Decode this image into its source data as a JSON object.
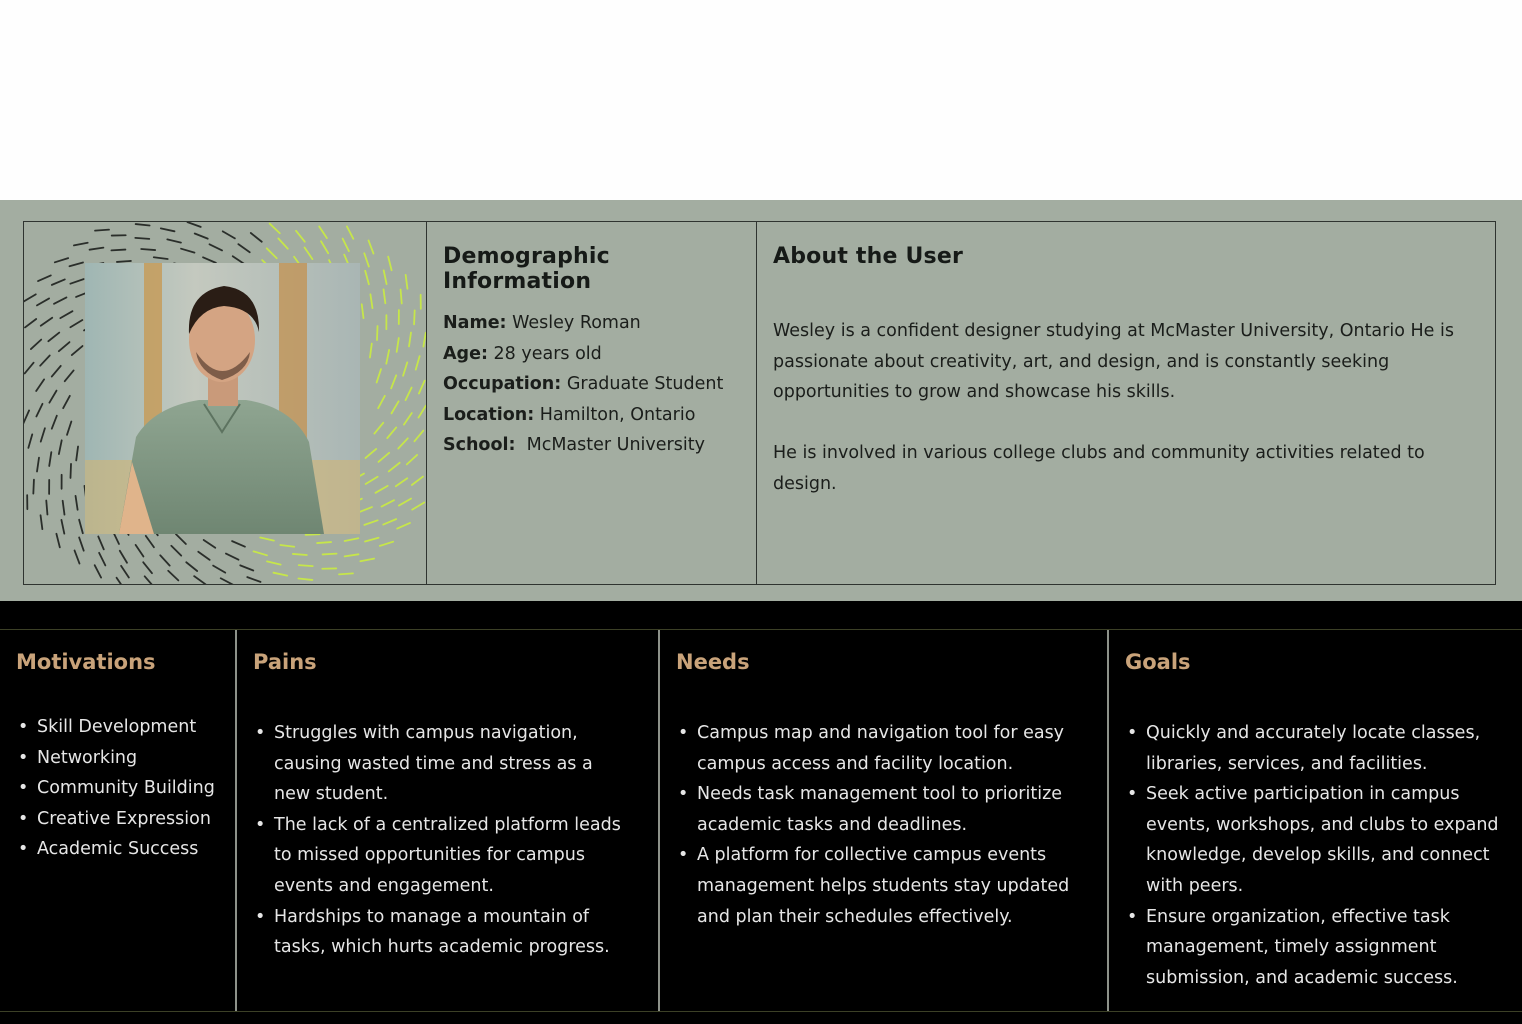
{
  "demographic": {
    "title": "Demographic Information",
    "name_label": "Name:",
    "name_value": " Wesley Roman",
    "age_label": "Age:",
    "age_value": " 28 years old",
    "occupation_label": "Occupation:",
    "occupation_value": " Graduate Student",
    "location_label": "Location:",
    "location_value": " Hamilton, Ontario",
    "school_label": "School:",
    "school_value": "  McMaster University"
  },
  "about": {
    "title": "About the User",
    "paragraph1": "Wesley is a confident designer studying at McMaster University, Ontario He is passionate about creativity, art, and design, and is constantly seeking opportunities to grow and showcase his skills.",
    "paragraph2": "He is involved in various college clubs and community activities related to design."
  },
  "motivations": {
    "title": "Motivations",
    "items": [
      "Skill Development",
      "Networking",
      "Community Building",
      "Creative Expression",
      "Academic Success"
    ]
  },
  "pains": {
    "title": "Pains",
    "items": [
      "Struggles with campus navigation, causing wasted time and stress as a new student.",
      "The lack of a centralized platform leads to missed opportunities for campus events and engagement.",
      "Hardships to manage a mountain of tasks, which hurts academic progress."
    ]
  },
  "needs": {
    "title": "Needs",
    "items": [
      "Campus map and navigation tool for easy campus access and facility location.",
      "Needs task management tool to prioritize academic tasks and deadlines.",
      "A platform for collective campus events management helps students stay updated and plan their schedules effectively."
    ]
  },
  "goals": {
    "title": "Goals",
    "items": [
      "Quickly and accurately locate classes, libraries, services, and facilities.",
      "Seek active participation in campus events, workshops, and clubs to expand knowledge, develop skills, and connect with peers.",
      "Ensure organization, effective task management, timely assignment submission, and academic success."
    ]
  },
  "colors": {
    "top_background": "#a3ada1",
    "bottom_background": "#000000",
    "card_title": "#c9a37a",
    "accent_lime": "#c6e64a"
  }
}
